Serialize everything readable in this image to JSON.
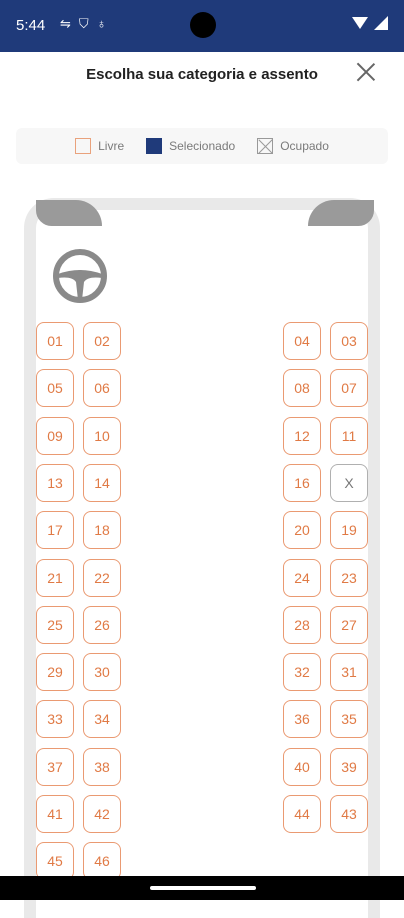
{
  "status": {
    "time": "5:44"
  },
  "header": {
    "title": "Escolha sua categoria e assento"
  },
  "legend": {
    "free": "Livre",
    "selected": "Selecionado",
    "occupied": "Ocupado"
  },
  "colors": {
    "accent": "#1f3a7a",
    "seat_border": "#ea9a72",
    "seat_text": "#e07a45",
    "occupied": "#b0b0b0"
  },
  "seats": [
    [
      "01",
      "02",
      "04",
      "03"
    ],
    [
      "05",
      "06",
      "08",
      "07"
    ],
    [
      "09",
      "10",
      "12",
      "11"
    ],
    [
      "13",
      "14",
      "16",
      "X"
    ],
    [
      "17",
      "18",
      "20",
      "19"
    ],
    [
      "21",
      "22",
      "24",
      "23"
    ],
    [
      "25",
      "26",
      "28",
      "27"
    ],
    [
      "29",
      "30",
      "32",
      "31"
    ],
    [
      "33",
      "34",
      "36",
      "35"
    ],
    [
      "37",
      "38",
      "40",
      "39"
    ],
    [
      "41",
      "42",
      "44",
      "43"
    ],
    [
      "45",
      "46",
      "",
      ""
    ]
  ]
}
